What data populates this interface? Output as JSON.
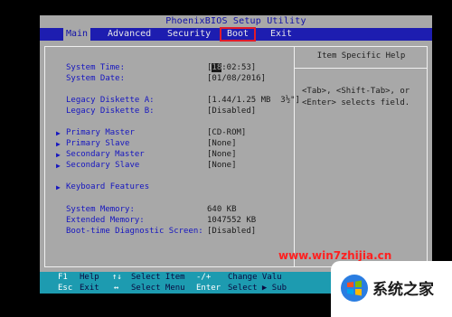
{
  "title": "PhoenixBIOS Setup Utility",
  "menu": [
    {
      "label": "Main"
    },
    {
      "label": "Advanced"
    },
    {
      "label": "Security"
    },
    {
      "label": "Boot"
    },
    {
      "label": "Exit"
    }
  ],
  "main": {
    "system_time_label": "System Time:",
    "system_time_cursor": "18",
    "system_time_rest": ":02:53]",
    "system_time_bracket": "[",
    "system_date_label": "System Date:",
    "system_date_value": "[01/08/2016]",
    "diskette_a_label": "Legacy Diskette A:",
    "diskette_a_value": "[1.44/1.25 MB  3½\"]",
    "diskette_b_label": "Legacy Diskette B:",
    "diskette_b_value": "[Disabled]",
    "primary_master_label": "Primary Master",
    "primary_master_value": "[CD-ROM]",
    "primary_slave_label": "Primary Slave",
    "primary_slave_value": "[None]",
    "secondary_master_label": "Secondary Master",
    "secondary_master_value": "[None]",
    "secondary_slave_label": "Secondary Slave",
    "secondary_slave_value": "[None]",
    "keyboard_features_label": "Keyboard Features",
    "system_memory_label": "System Memory:",
    "system_memory_value": "640 KB",
    "extended_memory_label": "Extended Memory:",
    "extended_memory_value": "1047552 KB",
    "boot_diag_label": "Boot-time Diagnostic Screen:",
    "boot_diag_value": "[Disabled]",
    "submenu_arrow": "▶"
  },
  "help": {
    "title": "Item Specific Help",
    "text": "<Tab>, <Shift-Tab>, or <Enter> selects field."
  },
  "status": {
    "k1": "F1",
    "d1": "Help",
    "k2": "↑↓",
    "d2": "Select Item",
    "k3": "-/+",
    "d3": "Change Valu",
    "k4": "Esc",
    "d4": "Exit",
    "k5": "↔",
    "d5": "Select Menu",
    "k6": "Enter",
    "d6": "Select ▶ Sub",
    "dangling": "e"
  },
  "watermark": {
    "url": "www.win7zhijia.cn",
    "site_name": "系统之家"
  },
  "colors": {
    "bios_gray": "#a8a8a8",
    "menu_blue": "#1d1db0",
    "label_blue": "#1515c0",
    "status_cyan": "#1d9bb0",
    "highlight_red": "#e21b2a"
  }
}
